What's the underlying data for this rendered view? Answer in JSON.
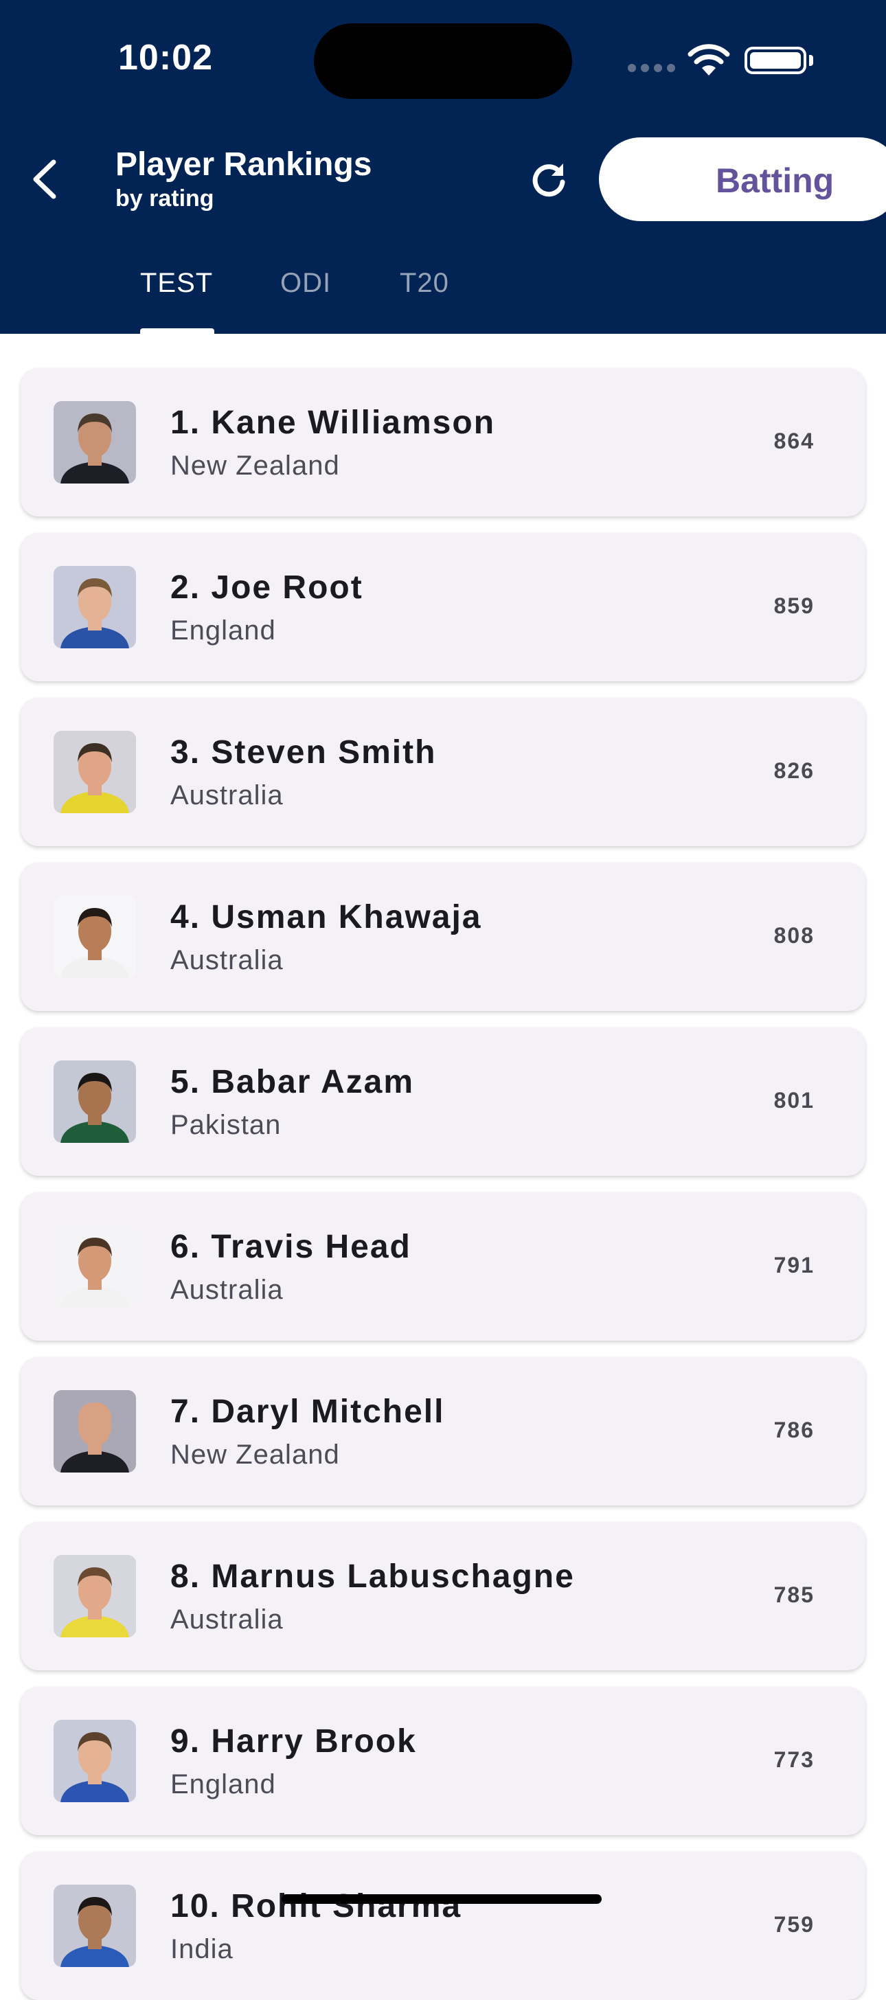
{
  "status_bar": {
    "time": "10:02"
  },
  "header": {
    "title": "Player Rankings",
    "subtitle": "by rating",
    "toggle_label": "Batting"
  },
  "tabs": [
    {
      "label": "TEST",
      "active": true
    },
    {
      "label": "ODI",
      "active": false
    },
    {
      "label": "T20",
      "active": false
    }
  ],
  "players": [
    {
      "name": "1. Kane Williamson",
      "country": "New Zealand",
      "rating": "864",
      "skin": "#c99373",
      "hair": "#4a3a2e",
      "shirt": "#1c1f26",
      "bg": "#b9b8c6"
    },
    {
      "name": "2. Joe Root",
      "country": "England",
      "rating": "859",
      "skin": "#e4b295",
      "hair": "#7a5a3a",
      "shirt": "#2a52a6",
      "bg": "#c6c9da"
    },
    {
      "name": "3. Steven Smith",
      "country": "Australia",
      "rating": "826",
      "skin": "#e0a587",
      "hair": "#3e2f25",
      "shirt": "#e6d42f",
      "bg": "#d3d3d9"
    },
    {
      "name": "4. Usman Khawaja",
      "country": "Australia",
      "rating": "808",
      "skin": "#b77e58",
      "hair": "#231a16",
      "shirt": "#f1f1f1",
      "bg": "#f6f6f8"
    },
    {
      "name": "5. Babar Azam",
      "country": "Pakistan",
      "rating": "801",
      "skin": "#a8734f",
      "hair": "#1a1614",
      "shirt": "#1f5c3a",
      "bg": "#c4c8d4"
    },
    {
      "name": "6. Travis Head",
      "country": "Australia",
      "rating": "791",
      "skin": "#d49a77",
      "hair": "#4b3626",
      "shirt": "#f2f2f2",
      "bg": "#f4f4f6"
    },
    {
      "name": "7. Daryl Mitchell",
      "country": "New Zealand",
      "rating": "786",
      "skin": "#d8a183",
      "hair": "#d8a183",
      "shirt": "#1d1f25",
      "bg": "#a9a8b4"
    },
    {
      "name": "8. Marnus Labuschagne",
      "country": "Australia",
      "rating": "785",
      "skin": "#e1a88a",
      "hair": "#6a4b31",
      "shirt": "#e9d93a",
      "bg": "#d6d7de"
    },
    {
      "name": "9. Harry Brook",
      "country": "England",
      "rating": "773",
      "skin": "#e6b294",
      "hair": "#5c412c",
      "shirt": "#2b55b0",
      "bg": "#c7cad8"
    },
    {
      "name": "10. Rohit Sharma",
      "country": "India",
      "rating": "759",
      "skin": "#ac7a57",
      "hair": "#1c1715",
      "shirt": "#2a5bb8",
      "bg": "#c5c8d4"
    }
  ],
  "colors": {
    "header_bg": "#022454",
    "card_bg": "#f4f2f7",
    "accent_purple": "#63539a"
  }
}
